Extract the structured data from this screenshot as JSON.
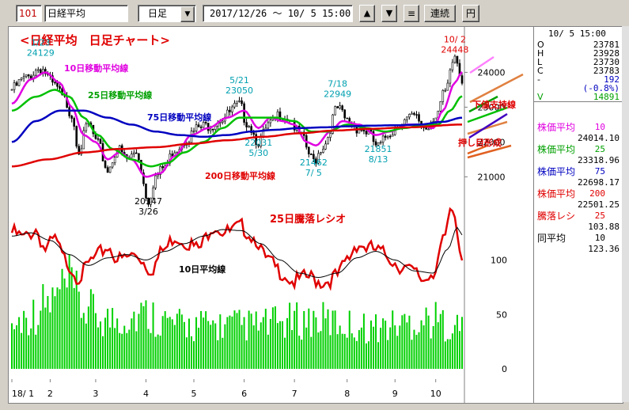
{
  "toolbar": {
    "code": "101",
    "name": "日経平均",
    "period": "日足",
    "range": "2017/12/26 ～ 10/ 5 15:00",
    "up": "▲",
    "down": "▼",
    "menu": "≡",
    "continuous": "連続",
    "yen": "円"
  },
  "quote": {
    "datetime": "10/ 5 15:00",
    "rows": [
      {
        "label": "O",
        "value": "23781"
      },
      {
        "label": "H",
        "value": "23928"
      },
      {
        "label": "L",
        "value": "23730"
      },
      {
        "label": "C",
        "value": "23783"
      },
      {
        "label": "-",
        "value": "192"
      },
      {
        "label": "",
        "value": "(-0.8%)"
      },
      {
        "label": "V",
        "value": "14891"
      }
    ]
  },
  "indicators": [
    {
      "label": "株価平均",
      "param": "10",
      "value": "24014.10",
      "color": "#e000e0"
    },
    {
      "label": "株価平均",
      "param": "25",
      "value": "23318.96",
      "color": "#00a000"
    },
    {
      "label": "株価平均",
      "param": "75",
      "value": "22698.17",
      "color": "#0000c0"
    },
    {
      "label": "株価平均",
      "param": "200",
      "value": "22501.25",
      "color": "#e00000"
    },
    {
      "label": "騰落レシ",
      "param": "25",
      "value": "103.88",
      "color": "#e00000"
    },
    {
      "label": "同平均",
      "param": "10",
      "value": "123.36",
      "color": "#000000"
    }
  ],
  "chart_data": {
    "type": "line",
    "title": "<日経平均　日足チャート>",
    "price_axis": {
      "ticks": [
        24000,
        23000,
        22000,
        21000
      ],
      "ylim": [
        19850,
        24850
      ]
    },
    "osc_axis": {
      "ticks": [
        100,
        50,
        0
      ],
      "ylim": [
        0,
        160
      ]
    },
    "x_ticks": [
      "18/ 1",
      "2",
      "3",
      "4",
      "5",
      "6",
      "7",
      "8",
      "9",
      "10"
    ],
    "annotations": [
      {
        "text": "10/ 2",
        "idx": 185,
        "color": "#e00000"
      },
      {
        "text": "24448",
        "idx": 185,
        "color": "#e00000"
      },
      {
        "text": "1/23",
        "idx": 12,
        "color": "#00a0b0"
      },
      {
        "text": "24129",
        "idx": 12,
        "color": "#00a0b0"
      },
      {
        "text": "5/21",
        "idx": 95,
        "color": "#00a0b0"
      },
      {
        "text": "23050",
        "idx": 95,
        "color": "#00a0b0"
      },
      {
        "text": "7/18",
        "idx": 136,
        "color": "#00a0b0"
      },
      {
        "text": "22949",
        "idx": 136,
        "color": "#00a0b0"
      },
      {
        "text": "20347",
        "idx": 57,
        "color": "#000000"
      },
      {
        "text": "3/26",
        "idx": 57,
        "color": "#000000"
      },
      {
        "text": "22031",
        "idx": 103,
        "color": "#00a0b0"
      },
      {
        "text": "5/30",
        "idx": 103,
        "color": "#00a0b0"
      },
      {
        "text": "21462",
        "idx": 126,
        "color": "#00a0b0"
      },
      {
        "text": "7/ 5",
        "idx": 126,
        "color": "#00a0b0"
      },
      {
        "text": "21851",
        "idx": 153,
        "color": "#00a0b0"
      },
      {
        "text": "8/13",
        "idx": 153,
        "color": "#00a0b0"
      }
    ],
    "labels": [
      {
        "text": "10日移動平均線",
        "color": "#e000e0"
      },
      {
        "text": "25日移動平均線",
        "color": "#00a000"
      },
      {
        "text": "75日移動平均線",
        "color": "#0000c0"
      },
      {
        "text": "200日移動平均線",
        "color": "#e00000"
      },
      {
        "text": "下値支持線",
        "color": "#e00000"
      },
      {
        "text": "押し目形成",
        "color": "#e00000"
      },
      {
        "text": "25日騰落レシオ",
        "color": "#e00000"
      },
      {
        "text": "10日平均線",
        "color": "#000000"
      }
    ],
    "series": [
      {
        "name": "株価",
        "anchors": [
          [
            0,
            23506
          ],
          [
            5,
            23800
          ],
          [
            12,
            24129
          ],
          [
            18,
            23600
          ],
          [
            22,
            23200
          ],
          [
            25,
            22800
          ],
          [
            28,
            21800
          ],
          [
            32,
            22500
          ],
          [
            36,
            21900
          ],
          [
            40,
            21200
          ],
          [
            44,
            21800
          ],
          [
            48,
            21500
          ],
          [
            52,
            21700
          ],
          [
            57,
            20347
          ],
          [
            60,
            21000
          ],
          [
            64,
            21300
          ],
          [
            68,
            21800
          ],
          [
            73,
            22100
          ],
          [
            78,
            22400
          ],
          [
            83,
            22500
          ],
          [
            88,
            22700
          ],
          [
            95,
            23050
          ],
          [
            98,
            22600
          ],
          [
            103,
            22031
          ],
          [
            108,
            22500
          ],
          [
            112,
            22800
          ],
          [
            116,
            22700
          ],
          [
            120,
            22200
          ],
          [
            126,
            21462
          ],
          [
            130,
            21900
          ],
          [
            136,
            22949
          ],
          [
            140,
            22600
          ],
          [
            145,
            22400
          ],
          [
            148,
            22300
          ],
          [
            153,
            21851
          ],
          [
            158,
            22300
          ],
          [
            163,
            22600
          ],
          [
            168,
            22700
          ],
          [
            173,
            22400
          ],
          [
            177,
            22800
          ],
          [
            181,
            23400
          ],
          [
            185,
            24448
          ],
          [
            188,
            23783
          ]
        ]
      },
      {
        "name": "10日移動平均",
        "anchors": [
          [
            0,
            23100
          ],
          [
            8,
            23800
          ],
          [
            14,
            24000
          ],
          [
            20,
            23700
          ],
          [
            25,
            23000
          ],
          [
            30,
            22200
          ],
          [
            35,
            22000
          ],
          [
            40,
            21500
          ],
          [
            45,
            21700
          ],
          [
            50,
            21500
          ],
          [
            56,
            21000
          ],
          [
            62,
            21100
          ],
          [
            68,
            21600
          ],
          [
            75,
            22200
          ],
          [
            82,
            22400
          ],
          [
            90,
            22700
          ],
          [
            97,
            22900
          ],
          [
            103,
            22400
          ],
          [
            108,
            22700
          ],
          [
            113,
            22600
          ],
          [
            118,
            22500
          ],
          [
            123,
            22000
          ],
          [
            127,
            21900
          ],
          [
            133,
            22300
          ],
          [
            138,
            22600
          ],
          [
            145,
            22500
          ],
          [
            152,
            22200
          ],
          [
            158,
            22300
          ],
          [
            165,
            22500
          ],
          [
            170,
            22500
          ],
          [
            176,
            22400
          ],
          [
            180,
            22900
          ],
          [
            185,
            23700
          ],
          [
            188,
            24014
          ]
        ]
      },
      {
        "name": "25日移動平均",
        "anchors": [
          [
            0,
            22900
          ],
          [
            10,
            23300
          ],
          [
            18,
            23500
          ],
          [
            24,
            23300
          ],
          [
            30,
            22700
          ],
          [
            36,
            22200
          ],
          [
            42,
            21800
          ],
          [
            50,
            21500
          ],
          [
            58,
            21300
          ],
          [
            65,
            21400
          ],
          [
            72,
            21700
          ],
          [
            80,
            22000
          ],
          [
            88,
            22400
          ],
          [
            95,
            22700
          ],
          [
            102,
            22700
          ],
          [
            110,
            22700
          ],
          [
            118,
            22600
          ],
          [
            125,
            22300
          ],
          [
            132,
            22300
          ],
          [
            140,
            22500
          ],
          [
            148,
            22400
          ],
          [
            156,
            22300
          ],
          [
            164,
            22400
          ],
          [
            172,
            22500
          ],
          [
            178,
            22500
          ],
          [
            183,
            22900
          ],
          [
            188,
            23319
          ]
        ]
      },
      {
        "name": "75日移動平均",
        "anchors": [
          [
            0,
            22000
          ],
          [
            10,
            22600
          ],
          [
            20,
            22900
          ],
          [
            30,
            22900
          ],
          [
            40,
            22700
          ],
          [
            50,
            22500
          ],
          [
            60,
            22300
          ],
          [
            70,
            22200
          ],
          [
            80,
            22150
          ],
          [
            90,
            22200
          ],
          [
            100,
            22300
          ],
          [
            110,
            22350
          ],
          [
            120,
            22400
          ],
          [
            130,
            22420
          ],
          [
            140,
            22450
          ],
          [
            150,
            22470
          ],
          [
            160,
            22480
          ],
          [
            170,
            22500
          ],
          [
            180,
            22580
          ],
          [
            188,
            22698
          ]
        ]
      },
      {
        "name": "200日移動平均",
        "anchors": [
          [
            0,
            21300
          ],
          [
            15,
            21500
          ],
          [
            30,
            21700
          ],
          [
            45,
            21800
          ],
          [
            60,
            21850
          ],
          [
            75,
            21950
          ],
          [
            90,
            22050
          ],
          [
            105,
            22150
          ],
          [
            120,
            22250
          ],
          [
            135,
            22330
          ],
          [
            150,
            22380
          ],
          [
            165,
            22420
          ],
          [
            188,
            22501
          ]
        ]
      },
      {
        "name": "25日騰落レシオ",
        "anchors": [
          [
            0,
            125
          ],
          [
            5,
            120
          ],
          [
            10,
            128
          ],
          [
            14,
            110
          ],
          [
            18,
            118
          ],
          [
            22,
            100
          ],
          [
            28,
            85
          ],
          [
            34,
            100
          ],
          [
            40,
            112
          ],
          [
            45,
            100
          ],
          [
            52,
            105
          ],
          [
            58,
            92
          ],
          [
            64,
            110
          ],
          [
            68,
            122
          ],
          [
            72,
            118
          ],
          [
            78,
            110
          ],
          [
            84,
            132
          ],
          [
            90,
            125
          ],
          [
            96,
            130
          ],
          [
            102,
            120
          ],
          [
            106,
            100
          ],
          [
            112,
            90
          ],
          [
            118,
            80
          ],
          [
            124,
            84
          ],
          [
            130,
            80
          ],
          [
            136,
            85
          ],
          [
            140,
            100
          ],
          [
            144,
            115
          ],
          [
            150,
            110
          ],
          [
            156,
            105
          ],
          [
            162,
            95
          ],
          [
            168,
            88
          ],
          [
            172,
            82
          ],
          [
            176,
            90
          ],
          [
            180,
            115
          ],
          [
            184,
            145
          ],
          [
            188,
            104
          ]
        ]
      },
      {
        "name": "10日平均線",
        "anchors": [
          [
            0,
            122
          ],
          [
            8,
            125
          ],
          [
            16,
            118
          ],
          [
            24,
            105
          ],
          [
            32,
            95
          ],
          [
            40,
            102
          ],
          [
            48,
            105
          ],
          [
            56,
            100
          ],
          [
            64,
            108
          ],
          [
            72,
            115
          ],
          [
            80,
            122
          ],
          [
            88,
            128
          ],
          [
            96,
            127
          ],
          [
            104,
            115
          ],
          [
            112,
            100
          ],
          [
            120,
            88
          ],
          [
            128,
            84
          ],
          [
            136,
            88
          ],
          [
            144,
            102
          ],
          [
            152,
            108
          ],
          [
            160,
            100
          ],
          [
            168,
            90
          ],
          [
            176,
            88
          ],
          [
            182,
            110
          ],
          [
            186,
            130
          ],
          [
            188,
            123
          ]
        ]
      }
    ]
  }
}
